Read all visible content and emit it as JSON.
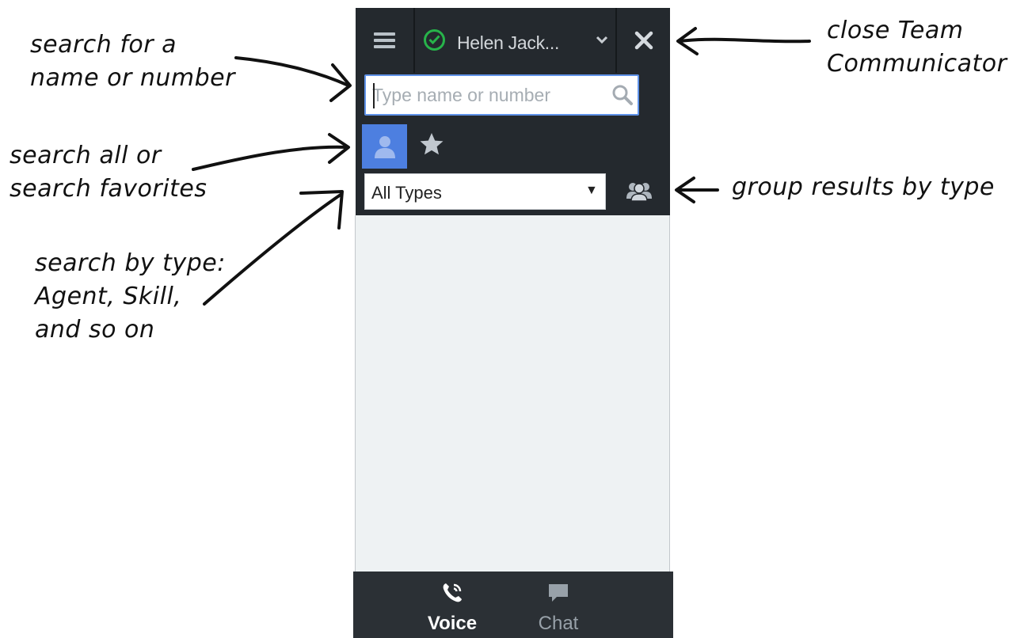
{
  "header": {
    "menu_icon": "hamburger-icon",
    "status_icon": "status-ready-check-icon",
    "status_color": "#27b34a",
    "agent_name": "Helen Jack...",
    "close_icon": "close-x-icon"
  },
  "search": {
    "placeholder": "Type name or number",
    "value": ""
  },
  "filters": {
    "all_icon": "person-icon",
    "favorites_icon": "star-icon",
    "type_select": "All Types",
    "group_icon": "group-people-icon"
  },
  "bottom_tabs": [
    {
      "label": "Voice",
      "icon": "phone-icon",
      "active": true
    },
    {
      "label": "Chat",
      "icon": "chat-bubble-icon",
      "active": false
    }
  ],
  "annotations": {
    "search_name": "search for a\nname or number",
    "close_team": "close Team\nCommunicator",
    "search_all": "search all or\nsearch favorites",
    "group_results": "group results by type",
    "search_type": "search by type:\nAgent, Skill,\nand so on"
  },
  "colors": {
    "panel_dark": "#24292e",
    "accent_blue": "#4d7fe0",
    "results_bg": "#eef2f3"
  }
}
